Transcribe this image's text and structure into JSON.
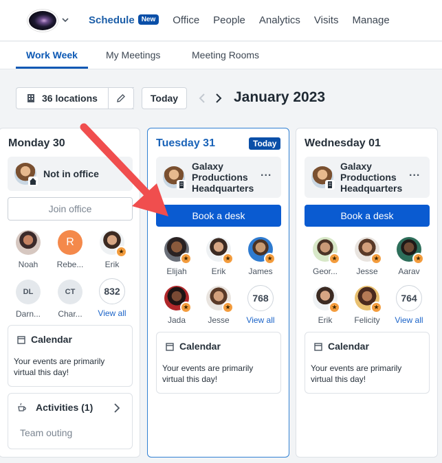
{
  "nav": {
    "items": [
      "Schedule",
      "Office",
      "People",
      "Analytics",
      "Visits",
      "Manage"
    ],
    "new_badge": "New"
  },
  "subnav": {
    "tabs": [
      "Work Week",
      "My Meetings",
      "Meeting Rooms"
    ]
  },
  "toolbar": {
    "locations": "36 locations",
    "today": "Today",
    "month": "January 2023"
  },
  "days": [
    {
      "title": "Monday 30",
      "status": "Not in office",
      "action": "Join office",
      "people": [
        {
          "name": "Noah"
        },
        {
          "name": "Rebe...",
          "initial": "R"
        },
        {
          "name": "Erik"
        },
        {
          "name": "Darn...",
          "initial": "DL"
        },
        {
          "name": "Char...",
          "initial": "CT"
        }
      ],
      "count": "832",
      "view_all": "View all",
      "calendar_title": "Calendar",
      "calendar_text": "Your events are primarily virtual this day!",
      "activities_title": "Activities (1)",
      "activities_item": "Team outing"
    },
    {
      "title": "Tuesday 31",
      "badge": "Today",
      "status": "Galaxy Productions Headquarters",
      "more": "...",
      "action": "Book a desk",
      "people": [
        {
          "name": "Elijah"
        },
        {
          "name": "Erik"
        },
        {
          "name": "James"
        },
        {
          "name": "Jada"
        },
        {
          "name": "Jesse"
        }
      ],
      "count": "768",
      "view_all": "View all",
      "calendar_title": "Calendar",
      "calendar_text": "Your events are primarily virtual this day!"
    },
    {
      "title": "Wednesday 01",
      "status": "Galaxy Productions Headquarters",
      "more": "...",
      "action": "Book a desk",
      "people": [
        {
          "name": "Geor..."
        },
        {
          "name": "Jesse"
        },
        {
          "name": "Aarav"
        },
        {
          "name": "Erik"
        },
        {
          "name": "Felicity"
        }
      ],
      "count": "764",
      "view_all": "View all",
      "calendar_title": "Calendar",
      "calendar_text": "Your events are primarily virtual this day!"
    }
  ],
  "colors": {
    "primary": "#0a5bd1",
    "annotation_arrow": "#f04e4e",
    "star_badge": "#f39c3d"
  }
}
